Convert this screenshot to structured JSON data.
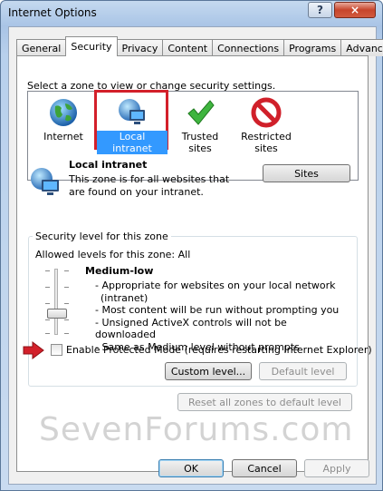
{
  "window": {
    "title": "Internet Options",
    "help_label": "?",
    "close_label": "×"
  },
  "tabs": [
    {
      "label": "General"
    },
    {
      "label": "Security"
    },
    {
      "label": "Privacy"
    },
    {
      "label": "Content"
    },
    {
      "label": "Connections"
    },
    {
      "label": "Programs"
    },
    {
      "label": "Advanced"
    }
  ],
  "active_tab": "Security",
  "security": {
    "instruction": "Select a zone to view or change security settings.",
    "zones": [
      {
        "label": "Internet",
        "icon": "globe-icon"
      },
      {
        "label": "Local intranet",
        "icon": "intranet-icon"
      },
      {
        "label": "Trusted sites",
        "icon": "checkmark-icon"
      },
      {
        "label": "Restricted sites",
        "icon": "restricted-icon"
      }
    ],
    "selected_zone": "Local intranet",
    "zone_detail": {
      "name": "Local intranet",
      "description": "This zone is for all websites that are found on your intranet.",
      "sites_button": "Sites"
    },
    "level_group": {
      "title": "Security level for this zone",
      "allowed": "Allowed levels for this zone: All",
      "level_name": "Medium-low",
      "bullets": [
        "- Appropriate for websites on your local network",
        "(intranet)",
        "- Most content will be run without prompting you",
        "- Unsigned ActiveX controls will not be downloaded",
        "- Same as Medium level without prompts"
      ],
      "protected_mode_label": "Enable Protected Mode (requires restarting Internet Explorer)",
      "protected_mode_checked": false,
      "custom_level_button": "Custom level...",
      "default_level_button": "Default level"
    },
    "reset_all_button": "Reset all zones to default level"
  },
  "watermark": {
    "part1": "Seven",
    "part2": "Forums",
    "part3": ".com"
  },
  "footer": {
    "ok": "OK",
    "cancel": "Cancel",
    "apply": "Apply"
  },
  "colors": {
    "highlight_frame": "#d3202a",
    "selection": "#3399ff"
  }
}
